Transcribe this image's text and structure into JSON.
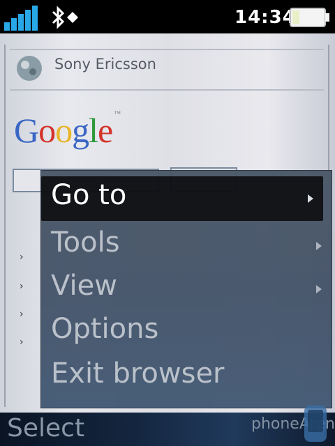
{
  "status_bar": {
    "time": "14:34",
    "signal_icon": "signal-bars-icon",
    "bluetooth_icon": "bluetooth-icon",
    "battery_icon": "battery-icon"
  },
  "browser": {
    "brand_text": "Sony Ericsson",
    "google_logo": {
      "letters": [
        "G",
        "o",
        "o",
        "g",
        "l",
        "e"
      ],
      "colors": [
        "#3a66c4",
        "#d4322a",
        "#e8b428",
        "#3a66c4",
        "#2e9a3c",
        "#d4322a"
      ],
      "tm": "™"
    },
    "bullet_glyph": "›"
  },
  "menu": {
    "items": [
      {
        "label": "Go to",
        "has_submenu": true,
        "selected": true
      },
      {
        "label": "Tools",
        "has_submenu": true,
        "selected": false
      },
      {
        "label": "View",
        "has_submenu": true,
        "selected": false
      },
      {
        "label": "Options",
        "has_submenu": false,
        "selected": false
      },
      {
        "label": "Exit browser",
        "has_submenu": false,
        "selected": false
      }
    ]
  },
  "softkeys": {
    "left": "Select"
  },
  "watermark": "phoneArena"
}
